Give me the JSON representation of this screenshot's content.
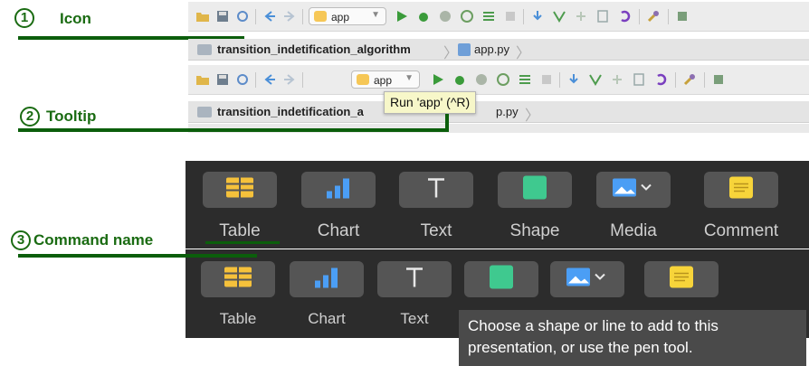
{
  "annotations": {
    "icon": {
      "number": "1",
      "label": "Icon"
    },
    "tooltip": {
      "number": "2",
      "label": "Tooltip"
    },
    "command": {
      "number": "3",
      "label": "Command name"
    }
  },
  "ide": {
    "run_config": "app",
    "breadcrumb_folder": "transition_indetification_algorithm",
    "breadcrumb_folder_short": "transition_indetification_a",
    "breadcrumb_file": "app.py",
    "breadcrumb_file_partial": "p.py",
    "tooltip": "Run 'app' (^R)"
  },
  "keynote": {
    "buttons": [
      {
        "label": "Table",
        "icon": "table-icon"
      },
      {
        "label": "Chart",
        "icon": "chart-icon"
      },
      {
        "label": "Text",
        "icon": "text-icon"
      },
      {
        "label": "Shape",
        "icon": "shape-icon"
      },
      {
        "label": "Media",
        "icon": "media-icon"
      },
      {
        "label": "Comment",
        "icon": "comment-icon"
      }
    ],
    "tooltip_line1": "Choose a shape or line to add to this",
    "tooltip_line2": "presentation, or use the pen tool."
  },
  "colors": {
    "annotation_green": "#1a6b12",
    "keynote_bg": "#2c2c2c",
    "keynote_button": "#555555",
    "table_yellow": "#f5c13b",
    "chart_blue": "#4b9ef5",
    "shape_green": "#3fc98f",
    "comment_yellow": "#f7d43a"
  }
}
